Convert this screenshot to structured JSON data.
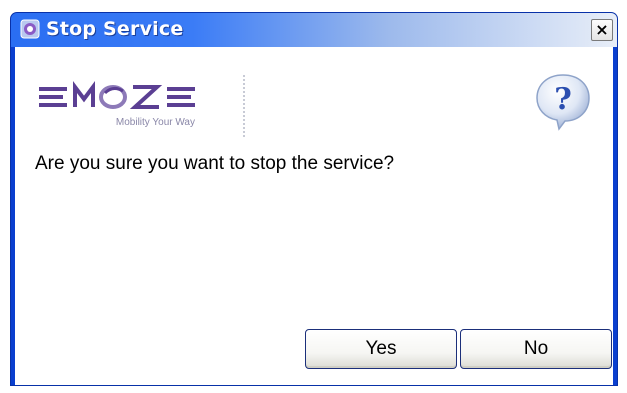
{
  "dialog": {
    "title": "Stop Service",
    "close_label": "×",
    "message": "Are you sure you want to stop the service?",
    "icon": "help-question-icon"
  },
  "logo": {
    "brand": "EMOZE",
    "tagline": "Mobility Your Way"
  },
  "buttons": {
    "yes_label": "Yes",
    "no_label": "No"
  },
  "colors": {
    "titlebar_start": "#2a6ef2",
    "titlebar_end": "#e8eef8",
    "frame": "#0a3fcf",
    "logo_purple": "#5b3f93",
    "help_blue": "#2c4fb0"
  }
}
